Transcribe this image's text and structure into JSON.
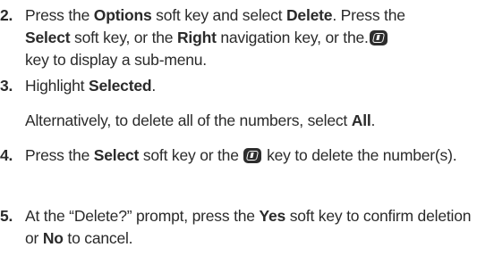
{
  "steps": [
    {
      "number": "2.",
      "parts": {
        "a": "Press the ",
        "b": "Options",
        "c": " soft key and select ",
        "d": "Delete",
        "e": ". Press the ",
        "f": "Select",
        "g": " soft key, or the ",
        "h": "Right",
        "i": " navigation key, or the.",
        "j": " key to display a sub-menu."
      }
    },
    {
      "number": "3.",
      "parts": {
        "a": "Highlight ",
        "b": "Selected",
        "c": "."
      },
      "note": {
        "a": "Alternatively, to delete all of the numbers, select ",
        "b": "All",
        "c": "."
      }
    },
    {
      "number": "4.",
      "parts": {
        "a": "Press the ",
        "b": "Select",
        "c": " soft key or the ",
        "d": " key to delete the number(s)."
      }
    },
    {
      "number": "5.",
      "parts": {
        "a": "At the “Delete?” prompt, press the ",
        "b": "Yes",
        "c": " soft key to confirm deletion or ",
        "d": "No",
        "e": " to cancel."
      }
    }
  ],
  "icons": {
    "nav_center_key": "ok-key-icon"
  }
}
